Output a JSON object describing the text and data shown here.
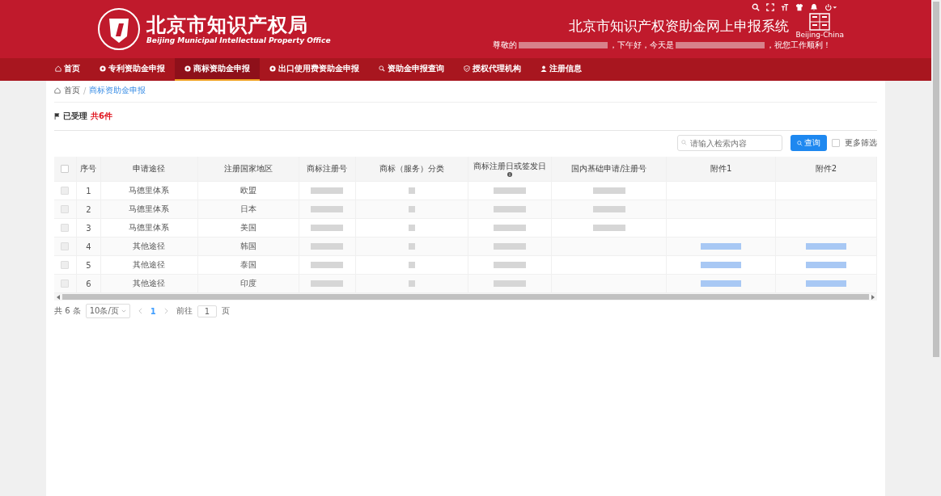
{
  "header": {
    "org_name": "北京市知识产权局",
    "org_name_en": "Beijing Municipal Intellectual Property Office",
    "system_title": "北京市知识产权资助金网上申报系统",
    "badge_caption": "Beijing-China",
    "greeting": [
      {
        "kind": "text",
        "text": "尊敬的"
      },
      {
        "kind": "redacted"
      },
      {
        "kind": "text",
        "text": "，下午好，今天是"
      },
      {
        "kind": "redacted"
      },
      {
        "kind": "text",
        "text": "，祝您工作顺利！"
      }
    ],
    "tools": [
      {
        "kind": "search"
      },
      {
        "kind": "fullscreen"
      },
      {
        "kind": "font"
      },
      {
        "kind": "theme"
      },
      {
        "kind": "bell"
      },
      {
        "kind": "power"
      }
    ]
  },
  "nav": [
    {
      "label": "首页",
      "kind": "home",
      "selected": false
    },
    {
      "label": "专利资助金申报",
      "kind": "circle",
      "selected": false
    },
    {
      "label": "商标资助金申报",
      "kind": "circle",
      "selected": true
    },
    {
      "label": "出口使用费资助金申报",
      "kind": "circle",
      "selected": false
    },
    {
      "label": "资助金申报查询",
      "kind": "search",
      "selected": false
    },
    {
      "label": "授权代理机构",
      "kind": "shield",
      "selected": false
    },
    {
      "label": "注册信息",
      "kind": "user",
      "selected": false
    }
  ],
  "breadcrumb": {
    "items": [
      "首页",
      "商标资助金申报"
    ],
    "separator": "/"
  },
  "section": {
    "title": "已受理",
    "count": "共6件"
  },
  "search": {
    "placeholder": "请输入检索内容",
    "button": "查询",
    "more_filter": {
      "label": "更多筛选",
      "checked": false
    }
  },
  "table": {
    "select_all_checked": false,
    "columns": [
      "序号",
      "申请途径",
      "注册国家地区",
      "商标注册号",
      "商标（服务）分类",
      "商标注册日或签发日",
      "国内基础申请/注册号",
      "附件1",
      "附件2"
    ],
    "rows": [
      {
        "checked": false,
        "cells": [
          {
            "kind": "text",
            "text": "1"
          },
          {
            "kind": "text",
            "text": "马德里体系"
          },
          {
            "kind": "text",
            "text": "欧盟"
          },
          {
            "kind": "redacted"
          },
          {
            "kind": "redacted_small"
          },
          {
            "kind": "redacted"
          },
          {
            "kind": "redacted"
          },
          {
            "kind": "empty"
          },
          {
            "kind": "empty"
          }
        ]
      },
      {
        "checked": false,
        "cells": [
          {
            "kind": "text",
            "text": "2"
          },
          {
            "kind": "text",
            "text": "马德里体系"
          },
          {
            "kind": "text",
            "text": "日本"
          },
          {
            "kind": "redacted"
          },
          {
            "kind": "redacted_small"
          },
          {
            "kind": "redacted"
          },
          {
            "kind": "redacted"
          },
          {
            "kind": "empty"
          },
          {
            "kind": "empty"
          }
        ]
      },
      {
        "checked": false,
        "cells": [
          {
            "kind": "text",
            "text": "3"
          },
          {
            "kind": "text",
            "text": "马德里体系"
          },
          {
            "kind": "text",
            "text": "美国"
          },
          {
            "kind": "redacted"
          },
          {
            "kind": "redacted_small"
          },
          {
            "kind": "redacted"
          },
          {
            "kind": "redacted"
          },
          {
            "kind": "empty"
          },
          {
            "kind": "empty"
          }
        ]
      },
      {
        "checked": false,
        "cells": [
          {
            "kind": "text",
            "text": "4"
          },
          {
            "kind": "text",
            "text": "其他途径"
          },
          {
            "kind": "text",
            "text": "韩国"
          },
          {
            "kind": "redacted"
          },
          {
            "kind": "redacted_small"
          },
          {
            "kind": "redacted"
          },
          {
            "kind": "empty"
          },
          {
            "kind": "redacted_link"
          },
          {
            "kind": "redacted_link"
          }
        ]
      },
      {
        "checked": false,
        "cells": [
          {
            "kind": "text",
            "text": "5"
          },
          {
            "kind": "text",
            "text": "其他途径"
          },
          {
            "kind": "text",
            "text": "泰国"
          },
          {
            "kind": "redacted"
          },
          {
            "kind": "redacted_small"
          },
          {
            "kind": "redacted"
          },
          {
            "kind": "empty"
          },
          {
            "kind": "redacted_link"
          },
          {
            "kind": "redacted_link"
          }
        ]
      },
      {
        "checked": false,
        "cells": [
          {
            "kind": "text",
            "text": "6"
          },
          {
            "kind": "text",
            "text": "其他途径"
          },
          {
            "kind": "text",
            "text": "印度"
          },
          {
            "kind": "redacted"
          },
          {
            "kind": "redacted_small"
          },
          {
            "kind": "redacted"
          },
          {
            "kind": "empty"
          },
          {
            "kind": "redacted_link"
          },
          {
            "kind": "redacted_link"
          }
        ]
      }
    ]
  },
  "pagination": {
    "total": "共 6 条",
    "page_size": "10条/页",
    "pages": [
      {
        "label": "1",
        "selected": true
      }
    ],
    "goto_label": "前往",
    "goto_value": "1",
    "goto_suffix": "页"
  }
}
